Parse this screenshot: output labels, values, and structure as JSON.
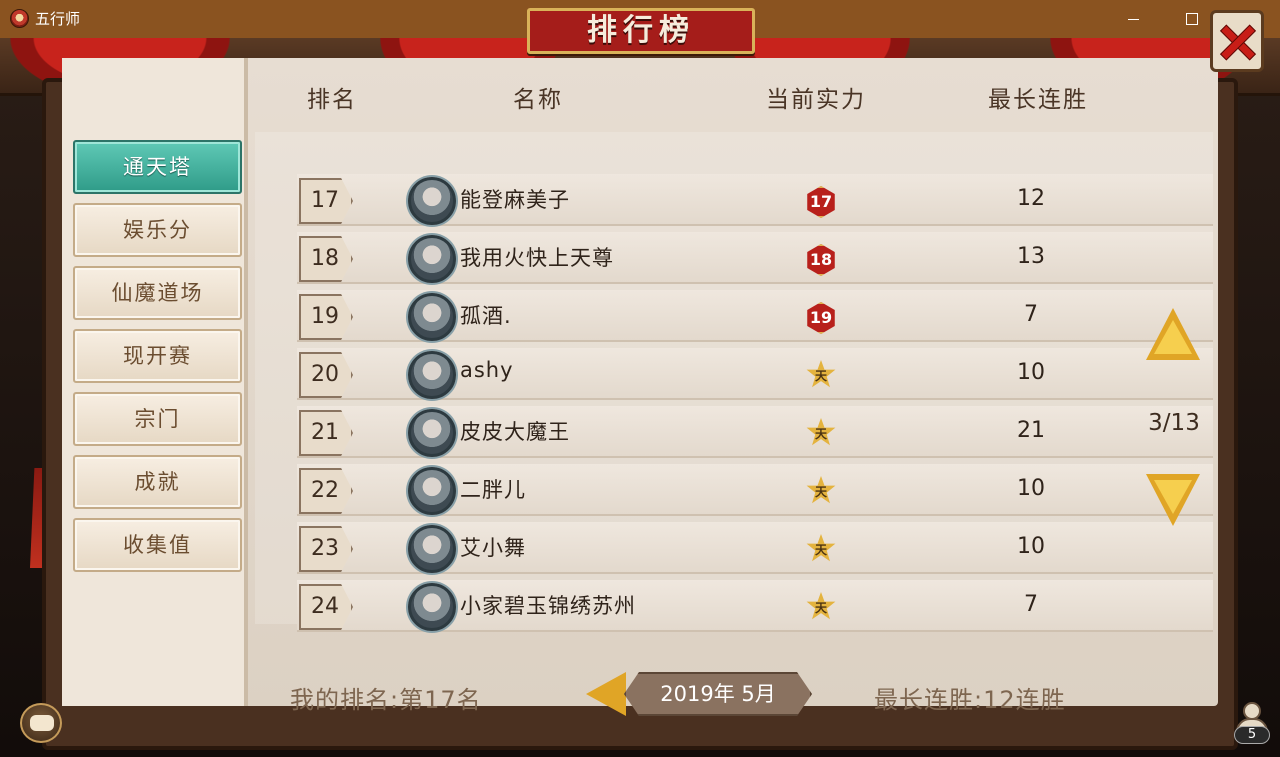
{
  "window": {
    "title": "五行师"
  },
  "title": "排行榜",
  "sidebar": {
    "items": [
      {
        "label": "通天塔",
        "active": true
      },
      {
        "label": "娱乐分",
        "active": false
      },
      {
        "label": "仙魔道场",
        "active": false
      },
      {
        "label": "现开赛",
        "active": false
      },
      {
        "label": "宗门",
        "active": false
      },
      {
        "label": "成就",
        "active": false
      },
      {
        "label": "收集值",
        "active": false
      }
    ]
  },
  "table": {
    "headers": {
      "rank": "排名",
      "name": "名称",
      "power": "当前实力",
      "streak": "最长连胜"
    },
    "rows": [
      {
        "rank": "17",
        "name": "能登麻美子",
        "power": "17",
        "power_type": "red",
        "streak": "12"
      },
      {
        "rank": "18",
        "name": "我用火快上天尊",
        "power": "18",
        "power_type": "red",
        "streak": "13"
      },
      {
        "rank": "19",
        "name": "孤酒.",
        "power": "19",
        "power_type": "red",
        "streak": "7"
      },
      {
        "rank": "20",
        "name": "ashy",
        "power": "天",
        "power_type": "gold",
        "streak": "10"
      },
      {
        "rank": "21",
        "name": "皮皮大魔王",
        "power": "天",
        "power_type": "gold",
        "streak": "21"
      },
      {
        "rank": "22",
        "name": "二胖儿",
        "power": "天",
        "power_type": "gold",
        "streak": "10"
      },
      {
        "rank": "23",
        "name": "艾小舞",
        "power": "天",
        "power_type": "gold",
        "streak": "10"
      },
      {
        "rank": "24",
        "name": "小家碧玉锦绣苏州",
        "power": "天",
        "power_type": "gold",
        "streak": "7"
      }
    ]
  },
  "pager": {
    "page": "3/13"
  },
  "footer": {
    "my_rank": "我的排名:第17名",
    "date": "2019年  5月",
    "best_streak": "最长连胜:12连胜"
  },
  "friends": {
    "count": "5"
  },
  "colors": {
    "accent_teal": "#2f9b88",
    "title_red": "#a51d1a",
    "arrow_gold": "#e0a526",
    "titlebar_brown": "#8a5320"
  },
  "icons": {
    "app": "app-logo-icon",
    "close": "close-x-icon",
    "page_up": "triangle-up-icon",
    "page_down": "triangle-down-icon",
    "prev_month": "triangle-left-icon",
    "chat": "chat-bubble-icon",
    "friends": "friends-icon"
  }
}
